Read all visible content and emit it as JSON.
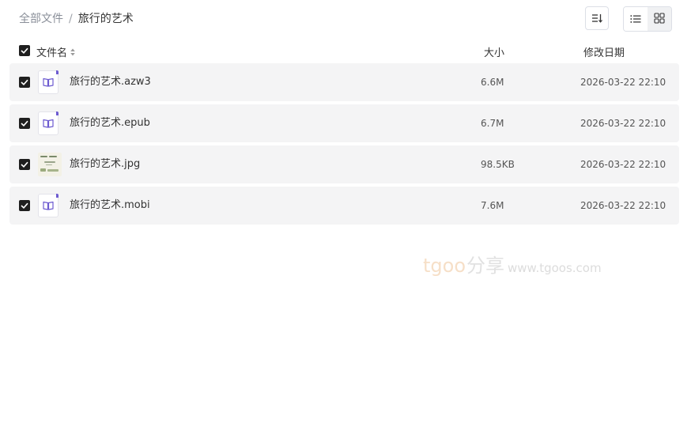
{
  "breadcrumb": {
    "root": "全部文件",
    "separator": "/",
    "current": "旅行的艺术"
  },
  "toolbar": {
    "sort_icon": "sort-icon",
    "list_view_icon": "list-view-icon",
    "grid_view_icon": "grid-view-icon",
    "active_view": "list"
  },
  "table": {
    "columns": {
      "name": "文件名",
      "size": "大小",
      "date": "修改日期"
    },
    "all_selected": true,
    "rows": [
      {
        "name": "旅行的艺术.azw3",
        "size": "6.6M",
        "date": "2026-03-22 22:10",
        "icon": "ebook-icon",
        "checked": true
      },
      {
        "name": "旅行的艺术.epub",
        "size": "6.7M",
        "date": "2026-03-22 22:10",
        "icon": "ebook-icon",
        "checked": true
      },
      {
        "name": "旅行的艺术.jpg",
        "size": "98.5KB",
        "date": "2026-03-22 22:10",
        "icon": "image-thumbnail",
        "checked": true
      },
      {
        "name": "旅行的艺术.mobi",
        "size": "7.6M",
        "date": "2026-03-22 22:10",
        "icon": "ebook-icon",
        "checked": true
      }
    ]
  },
  "watermark": {
    "brand": "tgoo",
    "cn": "分享",
    "url": "www.tgoos.com"
  },
  "colors": {
    "accent": "#6d5bd0",
    "checkbox": "#1f1f1f",
    "row_bg": "#f4f4f5",
    "muted_text": "#8a8f99"
  }
}
